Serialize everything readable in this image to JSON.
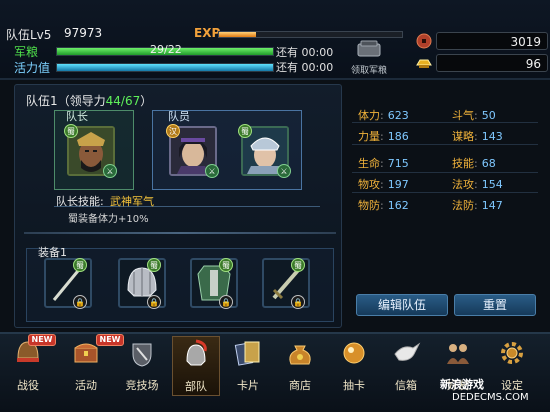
{
  "header": {
    "team_level": "队伍Lv5",
    "team_id": "97973",
    "exp_label": "EXP",
    "exp_progress": 0.2,
    "grain": {
      "label": "军粮",
      "value": "29/22",
      "recover": "还有 00:00",
      "progress": 1.0
    },
    "energy": {
      "label": "活力值",
      "recover": "还有 00:00",
      "progress": 1.0
    },
    "claim_label": "领取军粮",
    "currency": [
      {
        "icon": "copper-coin-icon",
        "value": "3019"
      },
      {
        "icon": "gold-ingot-icon",
        "value": "96"
      }
    ]
  },
  "team": {
    "title": "队伍1（领导力",
    "leadership": "44/67",
    "title_end": "）",
    "leader_tag": "队长",
    "member_tag": "队员",
    "skill_label": "队长技能:",
    "skill_name": "武神军气",
    "skill_desc": "蜀装备体力+10%",
    "equip_title": "装备1"
  },
  "stats": [
    {
      "k": "体力",
      "v": "623"
    },
    {
      "k": "斗气",
      "v": "50"
    },
    {
      "k": "力量",
      "v": "186"
    },
    {
      "k": "谋略",
      "v": "143"
    },
    {
      "k": "生命",
      "v": "715"
    },
    {
      "k": "技能",
      "v": "68"
    },
    {
      "k": "物攻",
      "v": "197"
    },
    {
      "k": "法攻",
      "v": "154"
    },
    {
      "k": "物防",
      "v": "162"
    },
    {
      "k": "法防",
      "v": "147"
    }
  ],
  "buttons": {
    "edit": "编辑队伍",
    "reset": "重置"
  },
  "nav": [
    {
      "label": "战役",
      "new": "NEW"
    },
    {
      "label": "活动",
      "new": "NEW"
    },
    {
      "label": "竞技场"
    },
    {
      "label": "部队"
    },
    {
      "label": "卡片"
    },
    {
      "label": "商店"
    },
    {
      "label": "抽卡"
    },
    {
      "label": "信箱"
    },
    {
      "label": "好友"
    },
    {
      "label": "设定"
    }
  ],
  "watermark": {
    "line1": "新浪游戏",
    "line2": "DEDECMS.COM"
  },
  "colors": {
    "accent_gold": "#f0b23a",
    "value_blue": "#7fc8ff",
    "green": "#4fe04a"
  }
}
